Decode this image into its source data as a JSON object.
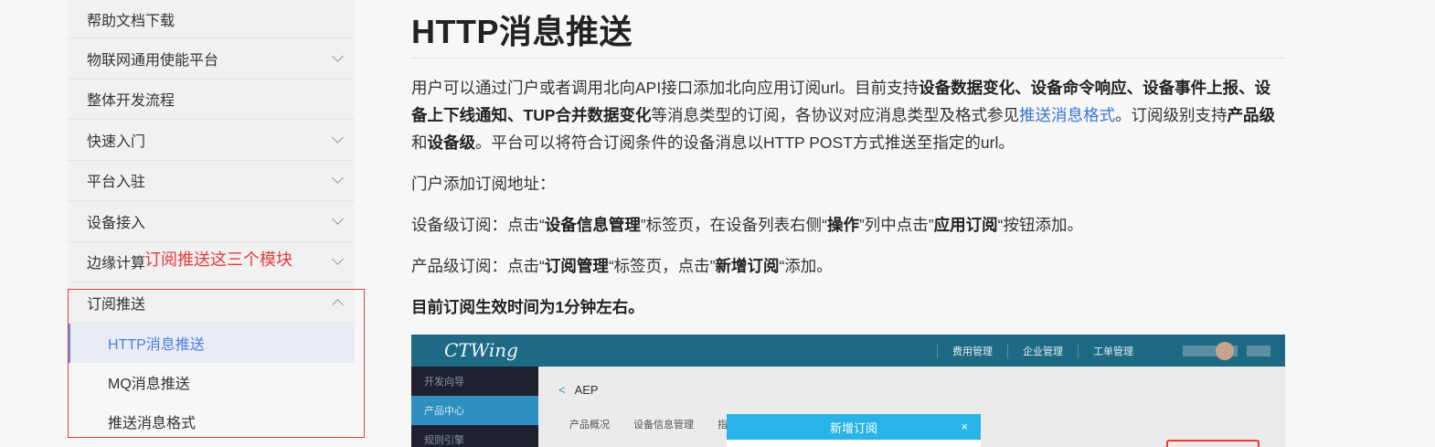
{
  "sidebar": {
    "items": [
      {
        "label": "帮助文档下载",
        "expandable": false
      },
      {
        "label": "物联网通用使能平台",
        "expandable": true
      },
      {
        "label": "整体开发流程",
        "expandable": false
      },
      {
        "label": "快速入门",
        "expandable": true
      },
      {
        "label": "平台入驻",
        "expandable": true
      },
      {
        "label": "设备接入",
        "expandable": true
      },
      {
        "label": "边缘计算",
        "expandable": true
      },
      {
        "label": "订阅推送",
        "expandable": true,
        "expanded": true
      }
    ],
    "sub_items": [
      {
        "label": "HTTP消息推送",
        "active": true
      },
      {
        "label": "MQ消息推送",
        "active": false
      },
      {
        "label": "推送消息格式",
        "active": false
      }
    ]
  },
  "annotation": {
    "text": "订阅推送这三个模块",
    "color": "#e83a3a"
  },
  "content": {
    "title": "HTTP消息推送",
    "p1": {
      "t1": "用户可以通过门户或者调用北向API接口添加北向应用订阅url。目前支持",
      "b1": "设备数据变化、设备命令响应、设备事件上报、设备上下线通知、TUP合并数据变化",
      "t2": "等消息类型的订阅，各协议对应消息类型及格式参见",
      "link": "推送消息格式",
      "t3": "。订阅级别支持",
      "b2": "产品级",
      "t4": "和",
      "b3": "设备级",
      "t5": "。平台可以将符合订阅条件的设备消息以HTTP POST方式推送至指定的url。"
    },
    "p2": "门户添加订阅地址：",
    "p3": {
      "t1": "设备级订阅：点击“",
      "b1": "设备信息管理",
      "t2": "”标签页，在设备列表右侧“",
      "b2": "操作",
      "t3": "”列中点击”",
      "b3": "应用订阅",
      "t4": "“按钮添加。"
    },
    "p4": {
      "t1": "产品级订阅：点击“",
      "b1": "订阅管理",
      "t2": "“标签页，点击”",
      "b2": "新增订阅",
      "t3": "“添加。"
    },
    "p5": "目前订阅生效时间为1分钟左右。"
  },
  "screenshot": {
    "logo": "CTWing",
    "menu": [
      "费用管理",
      "企业管理",
      "工单管理"
    ],
    "side": [
      "开发向导",
      "产品中心",
      "规则引擎"
    ],
    "back_label": "AEP",
    "tabs": [
      "产品概况",
      "设备信息管理",
      "指令"
    ],
    "modal_title": "新增订阅",
    "modal_close": "×"
  },
  "colors": {
    "link": "#3b73d6",
    "active_nav": "#4a7fe0",
    "annotation": "#e83a3a",
    "screenshot_header": "#1e6a84",
    "modal_header": "#28b4e8"
  }
}
